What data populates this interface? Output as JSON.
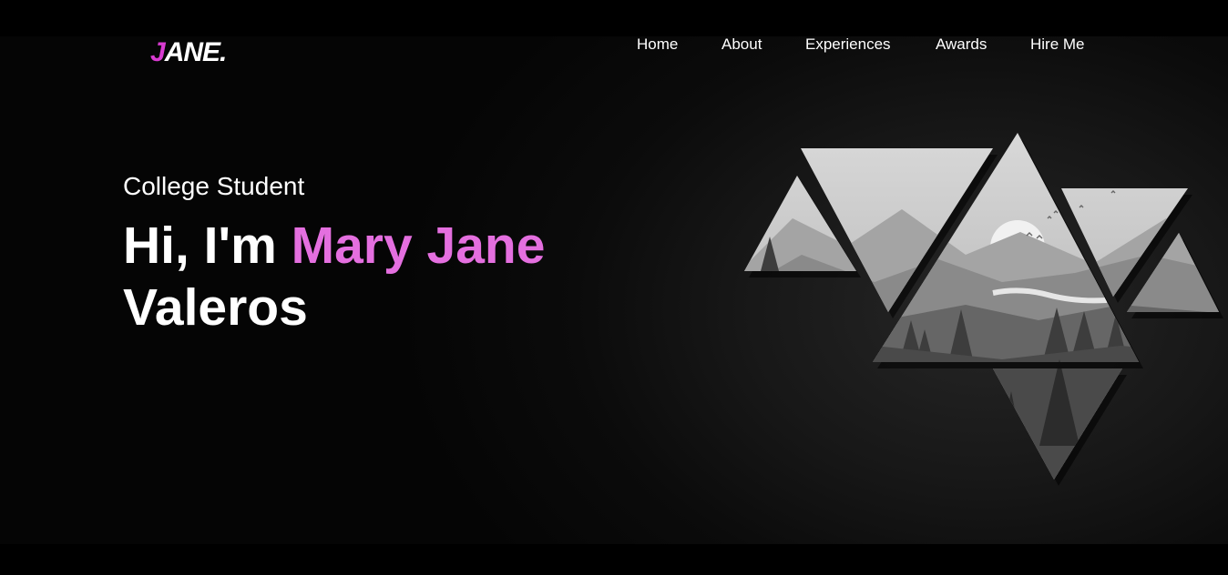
{
  "logo": {
    "first_letter": "J",
    "rest": "ANE",
    "dot": "."
  },
  "nav": {
    "items": [
      {
        "label": "Home"
      },
      {
        "label": "About"
      },
      {
        "label": "Experiences"
      },
      {
        "label": "Awards"
      },
      {
        "label": "Hire Me"
      }
    ]
  },
  "hero": {
    "subtitle": "College Student",
    "greeting": "Hi, I'm ",
    "name_highlight": "Mary Jane",
    "name_last": "Valeros",
    "art": {
      "icon": "triangle-landscape-illustration"
    }
  },
  "colors": {
    "accent": "#e46fdf",
    "logo_accent": "#d83bd0",
    "background": "#000000",
    "text": "#ffffff"
  }
}
